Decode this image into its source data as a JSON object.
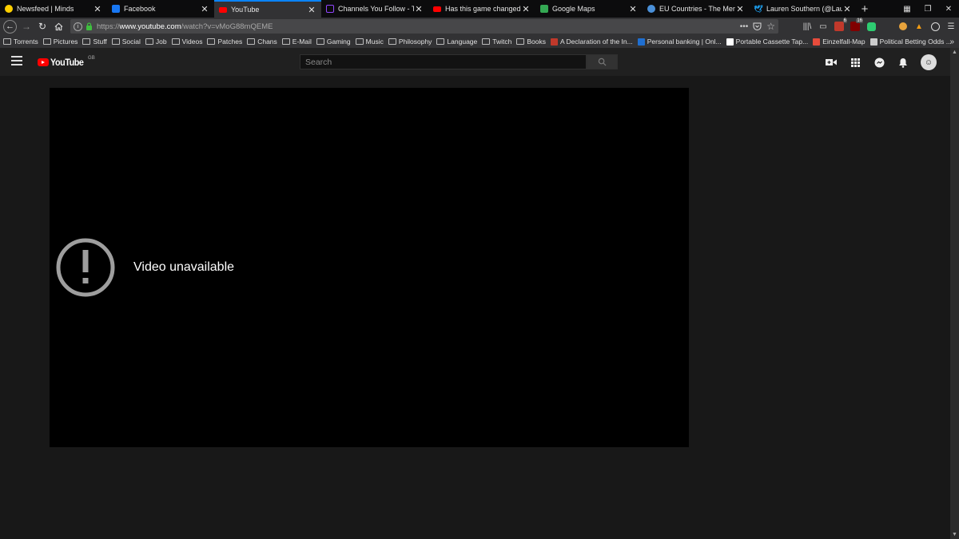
{
  "tabs": [
    {
      "title": "Newsfeed | Minds",
      "favicon": "minds-bulb-icon",
      "color": "#ffd000",
      "active": false
    },
    {
      "title": "Facebook",
      "favicon": "facebook-icon",
      "color": "#1877f2",
      "active": false
    },
    {
      "title": "YouTube",
      "favicon": "youtube-icon",
      "color": "#ff0000",
      "active": true
    },
    {
      "title": "Channels You Follow - Twitc",
      "favicon": "twitch-icon",
      "color": "#9146ff",
      "active": false
    },
    {
      "title": "Has this game changed in A",
      "favicon": "youtube-icon",
      "color": "#ff0000",
      "active": false
    },
    {
      "title": "Google Maps",
      "favicon": "google-maps-icon",
      "color": "#34a853",
      "active": false
    },
    {
      "title": "EU Countries - The Member",
      "favicon": "globe-icon",
      "color": "#4a90d9",
      "active": false
    },
    {
      "title": "Lauren Southern (@Lauren_S",
      "favicon": "twitter-icon",
      "color": "#1da1f2",
      "active": false
    }
  ],
  "tab_close_glyph": "✕",
  "new_tab_glyph": "+",
  "nav": {
    "url_scheme": "https://",
    "url_host": "www.youtube.com",
    "url_path": "/watch?v=vMoG88mQEME",
    "badge_count": "16",
    "badge_count_2": "6"
  },
  "bookmarks": [
    {
      "label": "Torrents",
      "type": "folder"
    },
    {
      "label": "Pictures",
      "type": "folder"
    },
    {
      "label": "Stuff",
      "type": "folder"
    },
    {
      "label": "Social",
      "type": "folder"
    },
    {
      "label": "Job",
      "type": "folder"
    },
    {
      "label": "Videos",
      "type": "folder"
    },
    {
      "label": "Patches",
      "type": "folder"
    },
    {
      "label": "Chans",
      "type": "folder"
    },
    {
      "label": "E-Mail",
      "type": "folder"
    },
    {
      "label": "Gaming",
      "type": "folder"
    },
    {
      "label": "Music",
      "type": "folder"
    },
    {
      "label": "Philosophy",
      "type": "folder"
    },
    {
      "label": "Language",
      "type": "folder"
    },
    {
      "label": "Twitch",
      "type": "folder"
    },
    {
      "label": "Books",
      "type": "folder"
    },
    {
      "label": "A Declaration of the In...",
      "type": "link",
      "color": "#c0392b"
    },
    {
      "label": "Personal banking | Onl...",
      "type": "link",
      "color": "#1f6fd1"
    },
    {
      "label": "Portable Cassette Tap...",
      "type": "link",
      "color": "#ffffff"
    },
    {
      "label": "Einzelfall-Map",
      "type": "link",
      "color": "#e74c3c"
    },
    {
      "label": "Political Betting Odds ...",
      "type": "link",
      "color": "#cccccc"
    }
  ],
  "bookmarks_more_glyph": "»",
  "youtube": {
    "logo_text": "YouTube",
    "region": "GB",
    "search_placeholder": "Search",
    "error_message": "Video unavailable"
  },
  "colors": {
    "accent": "#0a84ff",
    "youtube_red": "#ff0000",
    "page_bg": "#181818"
  }
}
